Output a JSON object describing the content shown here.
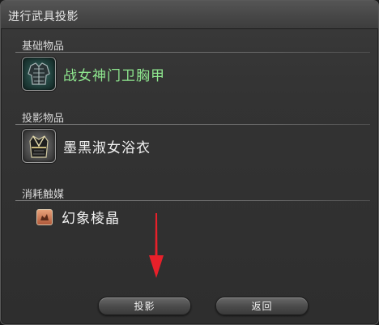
{
  "window": {
    "title": "进行武具投影"
  },
  "base_section": {
    "label": "基础物品",
    "item": {
      "name": "战女神门卫胸甲",
      "name_color": "#8fe88f",
      "icon": "armor-chest-icon"
    }
  },
  "projection_section": {
    "label": "投影物品",
    "item": {
      "name": "墨黑淑女浴衣",
      "name_color": "#f2f2f2",
      "icon": "robe-icon"
    }
  },
  "catalyst_section": {
    "label": "消耗触媒",
    "item": {
      "name": "幻象棱晶",
      "name_color": "#f2f2f2",
      "icon": "prism-icon"
    }
  },
  "buttons": {
    "project": "投影",
    "back": "返回"
  },
  "annotation": {
    "arrow_color": "#e8202a"
  }
}
